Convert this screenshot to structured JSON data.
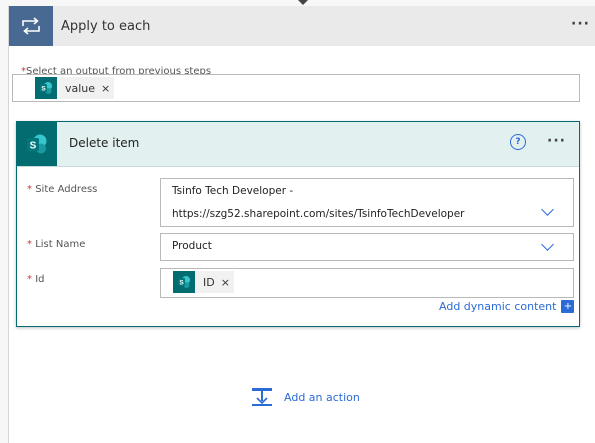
{
  "loop": {
    "title": "Apply to each",
    "more": "···",
    "output_label": "Select an output from previous steps",
    "required_mark": "*",
    "token_label": "value",
    "token_remove": "×"
  },
  "action": {
    "title": "Delete item",
    "help": "?",
    "more": "···",
    "fields": {
      "site": {
        "label": "Site Address",
        "line1": "Tsinfo Tech Developer -",
        "line2": "https://szg52.sharepoint.com/sites/TsinfoTechDeveloper"
      },
      "list": {
        "label": "List Name",
        "value": "Product"
      },
      "id": {
        "label": "Id",
        "token_label": "ID",
        "token_remove": "×"
      }
    },
    "dynamic_content": "Add dynamic content",
    "dynamic_plus": "+"
  },
  "add_action": {
    "label": "Add an action"
  },
  "colors": {
    "loop_accent": "#486991",
    "sharepoint": "#036c70",
    "link": "#2b6bd6",
    "required": "#d13438"
  }
}
